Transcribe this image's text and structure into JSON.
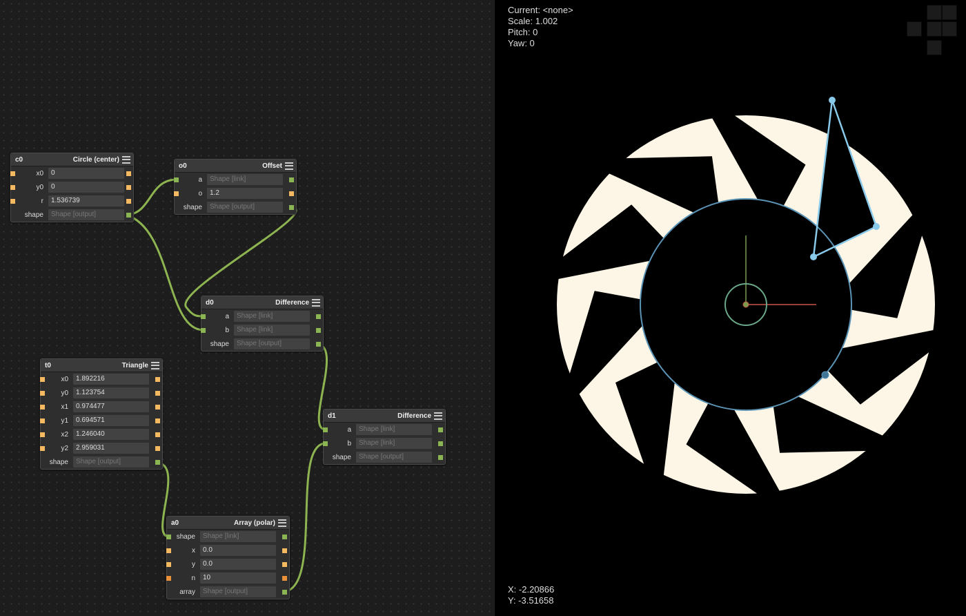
{
  "graph": {
    "nodes": {
      "c0": {
        "name": "c0",
        "title": "Circle (center)",
        "rows": [
          {
            "label": "x0",
            "value": "0"
          },
          {
            "label": "y0",
            "value": "0"
          },
          {
            "label": "r",
            "value": "1.536739"
          }
        ],
        "output": {
          "label": "shape",
          "placeholder": "Shape [output]"
        }
      },
      "o0": {
        "name": "o0",
        "title": "Offset",
        "rows": [
          {
            "label": "a",
            "placeholder": "Shape [link]"
          },
          {
            "label": "o",
            "value": "1.2"
          }
        ],
        "output": {
          "label": "shape",
          "placeholder": "Shape [output]"
        }
      },
      "d0": {
        "name": "d0",
        "title": "Difference",
        "rows": [
          {
            "label": "a",
            "placeholder": "Shape [link]"
          },
          {
            "label": "b",
            "placeholder": "Shape [link]"
          }
        ],
        "output": {
          "label": "shape",
          "placeholder": "Shape [output]"
        }
      },
      "t0": {
        "name": "t0",
        "title": "Triangle",
        "rows": [
          {
            "label": "x0",
            "value": "1.892216"
          },
          {
            "label": "y0",
            "value": "1.123754"
          },
          {
            "label": "x1",
            "value": "0.974477"
          },
          {
            "label": "y1",
            "value": "0.694571"
          },
          {
            "label": "x2",
            "value": "1.246040"
          },
          {
            "label": "y2",
            "value": "2.959031"
          }
        ],
        "output": {
          "label": "shape",
          "placeholder": "Shape [output]"
        }
      },
      "d1": {
        "name": "d1",
        "title": "Difference",
        "rows": [
          {
            "label": "a",
            "placeholder": "Shape [link]"
          },
          {
            "label": "b",
            "placeholder": "Shape [link]"
          }
        ],
        "output": {
          "label": "shape",
          "placeholder": "Shape [output]"
        }
      },
      "a0": {
        "name": "a0",
        "title": "Array (polar)",
        "rows": [
          {
            "label": "shape",
            "placeholder": "Shape [link]"
          },
          {
            "label": "x",
            "value": "0.0"
          },
          {
            "label": "y",
            "value": "0.0"
          },
          {
            "label": "n",
            "value": "10"
          }
        ],
        "output": {
          "label": "array",
          "placeholder": "Shape [output]"
        }
      }
    },
    "wire_color": "#8db450"
  },
  "viewport": {
    "status": {
      "current": "Current: <none>",
      "scale": "Scale: 1.002",
      "pitch": "Pitch: 0",
      "yaw": "Yaw: 0"
    },
    "cursor": {
      "x": "X: -2.20866",
      "y": "Y: -3.51658"
    },
    "shape_color": "#fdf6e6",
    "handle_color": "#89c9ea",
    "circle_outline_color": "#5b93b5",
    "axis_x_color": "#c8554a",
    "axis_y_color": "#7a9e4d",
    "array_n": 10
  }
}
